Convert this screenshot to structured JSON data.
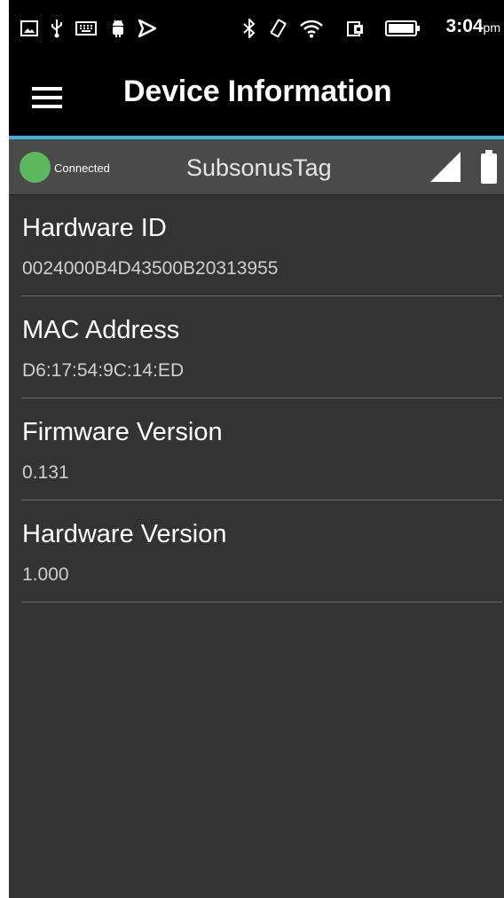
{
  "status_bar": {
    "icons": [
      "gallery-icon",
      "usb-icon",
      "keyboard-icon",
      "android-icon",
      "play-store-icon",
      "bluetooth-icon",
      "vibrate-icon",
      "wifi-icon",
      "nfc-icon",
      "battery-icon"
    ],
    "time": "3:04",
    "ampm": "pm"
  },
  "app_bar": {
    "title": "Device Information",
    "menu_icon": "hamburger-menu-icon"
  },
  "connection": {
    "status": "Connected",
    "status_color": "#5cb85c",
    "device_name": "SubsonusTag",
    "signal_icon": "signal-strength-icon",
    "battery_icon": "device-battery-icon"
  },
  "accent_color": "#3fb3e0",
  "info": {
    "items": [
      {
        "label": "Hardware ID",
        "value": "0024000B4D43500B20313955"
      },
      {
        "label": "MAC Address",
        "value": "D6:17:54:9C:14:ED"
      },
      {
        "label": "Firmware Version",
        "value": "0.131"
      },
      {
        "label": "Hardware Version",
        "value": "1.000"
      }
    ]
  }
}
